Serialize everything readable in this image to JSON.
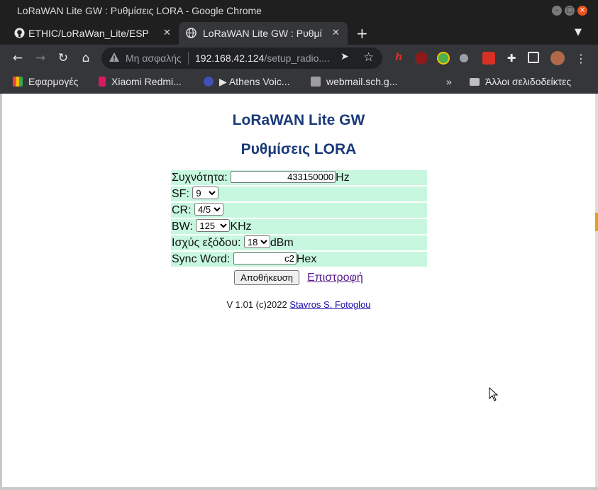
{
  "window": {
    "title": "LoRaWAN Lite GW : Ρυθμίσεις LORA - Google Chrome"
  },
  "tabs": [
    {
      "label": "ETHIC/LoRaWan_Lite/ESP",
      "icon": "github-icon"
    },
    {
      "label": "LoRaWAN Lite GW : Ρυθμί",
      "icon": "globe-icon"
    }
  ],
  "omnibox": {
    "security_label": "Μη ασφαλής",
    "url_host": "192.168.42.124",
    "url_path": "/setup_radio...."
  },
  "bookmarks": [
    {
      "label": "Εφαρμογές",
      "icon": "apps-grid-icon"
    },
    {
      "label": "Xiaomi Redmi...",
      "icon": "bookmark-favicon"
    },
    {
      "label": "▶ Athens Voic...",
      "icon": "av-favicon"
    },
    {
      "label": "webmail.sch.g...",
      "icon": "webmail-favicon"
    },
    {
      "label": "»",
      "icon": "overflow-icon"
    },
    {
      "label": "Άλλοι σελιδοδείκτες",
      "icon": "folder-icon"
    }
  ],
  "page": {
    "heading": "LoRaWAN Lite GW",
    "subheading": "Ρυθμίσεις LORA",
    "fields": {
      "frequency": {
        "label": "Συχνότητα:",
        "value": "433150000",
        "unit": "Hz"
      },
      "sf": {
        "label": "SF:",
        "value": "9"
      },
      "cr": {
        "label": "CR:",
        "value": "4/5"
      },
      "bw": {
        "label": "BW:",
        "value": "125",
        "unit": "KHz"
      },
      "power": {
        "label": "Ισχύς εξόδου:",
        "value": "18",
        "unit": "dBm"
      },
      "sync": {
        "label": "Sync Word:",
        "value": "c2",
        "unit": "Hex"
      }
    },
    "save_label": "Αποθήκευση",
    "back_label": "Επιστροφή",
    "footer_text": "V 1.01 (c)2022 ",
    "footer_link": "Stavros S. Fotoglou"
  },
  "colors": {
    "row_bg": "#c8f7e0",
    "heading": "#1a3a7a",
    "link_visited": "#551a8b"
  }
}
